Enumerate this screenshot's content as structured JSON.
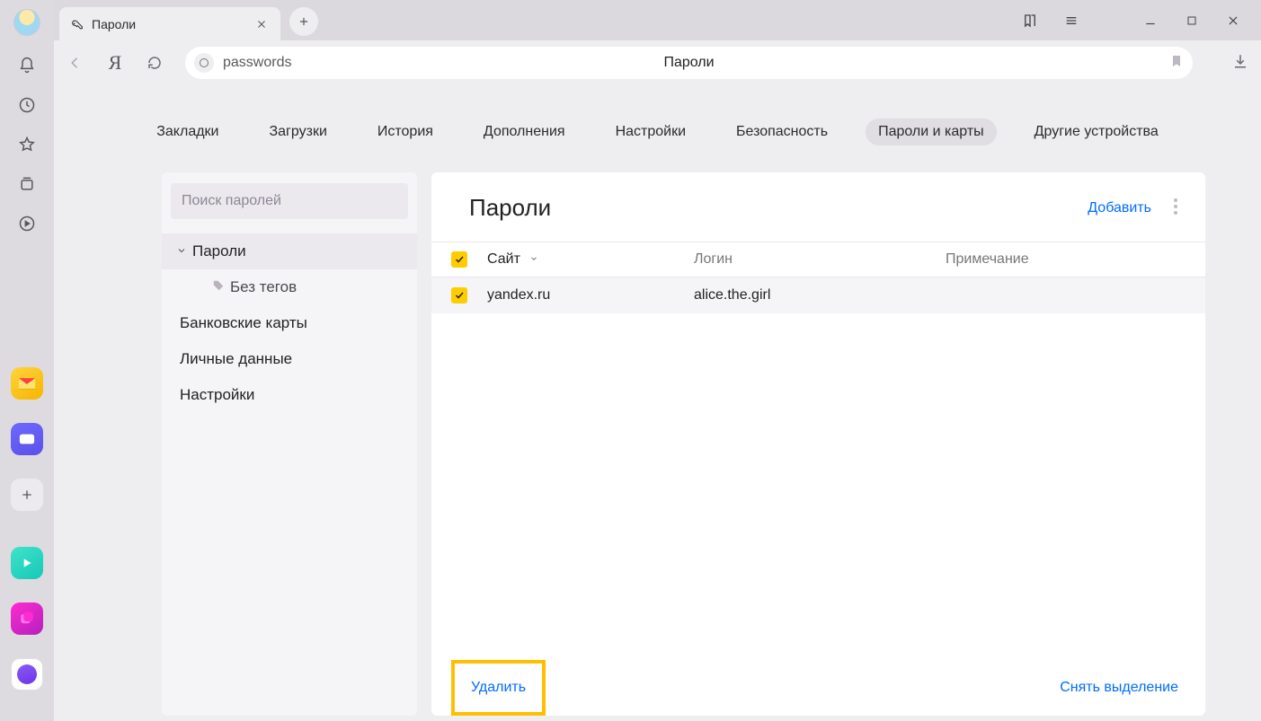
{
  "tab": {
    "title": "Пароли"
  },
  "addressbar": {
    "url_text": "passwords",
    "page_title": "Пароли"
  },
  "nav": {
    "items": [
      "Закладки",
      "Загрузки",
      "История",
      "Дополнения",
      "Настройки",
      "Безопасность",
      "Пароли и карты",
      "Другие устройства"
    ],
    "active_index": 6
  },
  "sidepanel": {
    "search_placeholder": "Поиск паролей",
    "group_label": "Пароли",
    "untagged_label": "Без тегов",
    "items": [
      "Банковские карты",
      "Личные данные",
      "Настройки"
    ]
  },
  "main": {
    "heading": "Пароли",
    "add_label": "Добавить",
    "columns": {
      "site": "Сайт",
      "login": "Логин",
      "note": "Примечание"
    },
    "rows": [
      {
        "site": "yandex.ru",
        "login": "alice.the.girl",
        "note": ""
      }
    ],
    "footer": {
      "delete": "Удалить",
      "deselect": "Снять выделение"
    }
  }
}
